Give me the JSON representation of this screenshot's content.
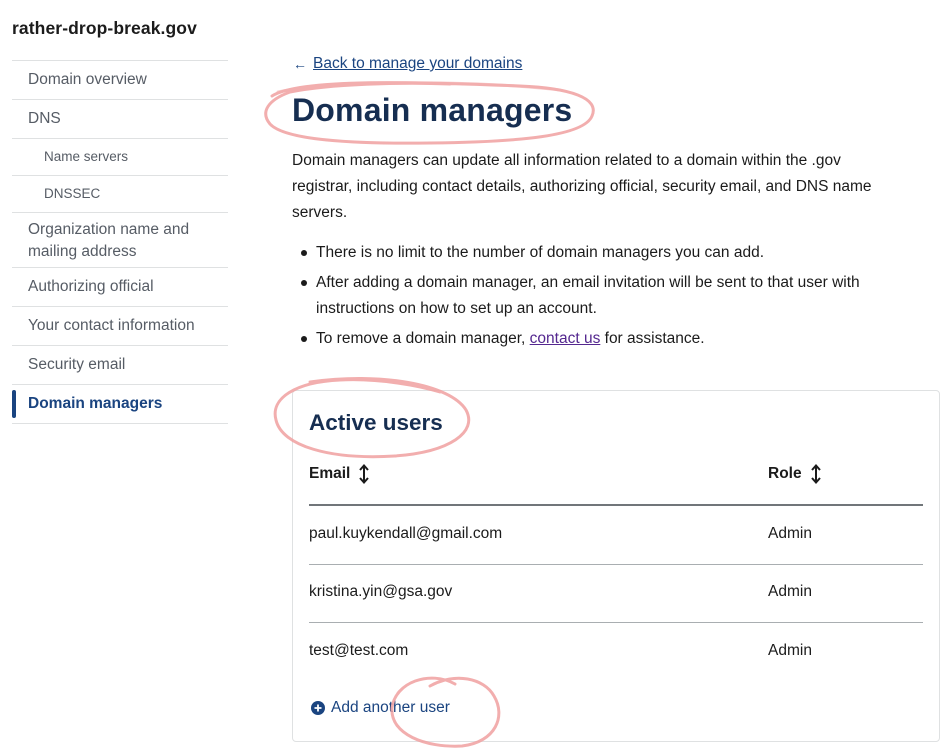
{
  "site": {
    "domain_name": "rather-drop-break.gov"
  },
  "sidebar": {
    "items": [
      {
        "label": "Domain overview"
      },
      {
        "label": "DNS"
      },
      {
        "label": "Name servers"
      },
      {
        "label": "DNSSEC"
      },
      {
        "label": "Organization name and mailing address"
      },
      {
        "label": "Authorizing official"
      },
      {
        "label": "Your contact information"
      },
      {
        "label": "Security email"
      },
      {
        "label": "Domain managers"
      }
    ]
  },
  "main": {
    "back_link": "Back to manage your domains",
    "title": "Domain managers",
    "intro": "Domain managers can update all information related to a domain within the .gov registrar, including contact details, authorizing official, security email, and DNS name servers.",
    "bullets": [
      "There is no limit to the number of domain managers you can add.",
      "After adding a domain manager, an email invitation will be sent to that user with instructions on how to set up an account."
    ],
    "remove_note": {
      "before": "To remove a domain manager, ",
      "link": "contact us",
      "after": " for assistance."
    }
  },
  "active_users": {
    "title": "Active users",
    "columns": {
      "email": "Email",
      "role": "Role"
    },
    "rows": [
      {
        "email": "paul.kuykendall@gmail.com",
        "role": "Admin"
      },
      {
        "email": "kristina.yin@gsa.gov",
        "role": "Admin"
      },
      {
        "email": "test@test.com",
        "role": "Admin"
      }
    ],
    "add_label": "Add another user"
  },
  "icons": {
    "back": "arrow-left-icon",
    "sort": "sort-arrows-icon",
    "add": "add-circle-icon"
  },
  "colors": {
    "primary": "#1a4480",
    "heading": "#162e51",
    "visited_link": "#54278f",
    "border": "#dfe1e2",
    "annotation": "#f0a0a0"
  }
}
